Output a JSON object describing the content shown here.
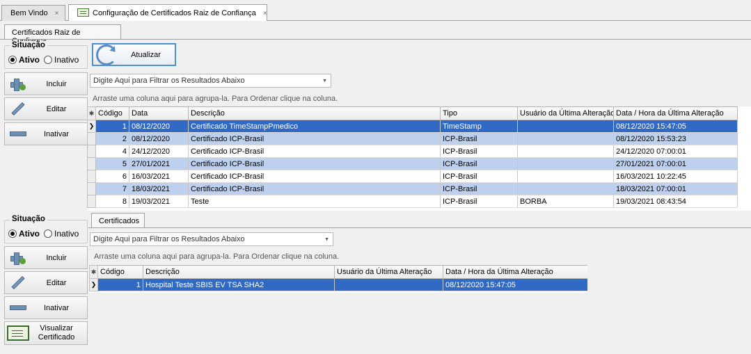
{
  "doc_tabs": [
    {
      "label": "Bem Vindo",
      "close": "×"
    },
    {
      "label": "Configuração de Certificados Raiz de Confiança",
      "close": "×"
    }
  ],
  "top": {
    "sub_tab": "Certificados Raiz de Confiança",
    "situacao": {
      "legend": "Situação",
      "ativo": "Ativo",
      "inativo": "Inativo"
    },
    "buttons": {
      "incluir": "Incluir",
      "editar": "Editar",
      "inativar": "Inativar"
    },
    "atualizar": "Atualizar",
    "filter_placeholder": "Digite Aqui para Filtrar os Resultados Abaixo",
    "group_hint": "Arraste uma coluna aqui para agrupa-la. Para Ordenar clique na coluna.",
    "columns": [
      "Código",
      "Data",
      "Descrição",
      "Tipo",
      "Usuário da Última Alteração",
      "Data / Hora da Última Alteração"
    ],
    "rows": [
      [
        "1",
        "08/12/2020",
        "Certificado TimeStampPmedico",
        "TimeStamp",
        "",
        "08/12/2020 15:47:05"
      ],
      [
        "2",
        "08/12/2020",
        "Certificado ICP-Brasil",
        "ICP-Brasil",
        "",
        "08/12/2020 15:53:23"
      ],
      [
        "4",
        "24/12/2020",
        "Certificado ICP-Brasil",
        "ICP-Brasil",
        "",
        "24/12/2020 07:00:01"
      ],
      [
        "5",
        "27/01/2021",
        "Certificado ICP-Brasil",
        "ICP-Brasil",
        "",
        "27/01/2021 07:00:01"
      ],
      [
        "6",
        "16/03/2021",
        "Certificado ICP-Brasil",
        "ICP-Brasil",
        "",
        "16/03/2021 10:22:45"
      ],
      [
        "7",
        "18/03/2021",
        "Certificado ICP-Brasil",
        "ICP-Brasil",
        "",
        "18/03/2021 07:00:01"
      ],
      [
        "8",
        "19/03/2021",
        "Teste",
        "ICP-Brasil",
        "BORBA",
        "19/03/2021 08:43:54"
      ]
    ]
  },
  "bottom": {
    "sub_tab": "Certificados",
    "situacao": {
      "legend": "Situação",
      "ativo": "Ativo",
      "inativo": "Inativo"
    },
    "buttons": {
      "incluir": "Incluir",
      "editar": "Editar",
      "inativar": "Inativar",
      "visualizar_1": "Visualizar",
      "visualizar_2": "Certificado"
    },
    "filter_placeholder": "Digite Aqui para Filtrar os Resultados Abaixo",
    "group_hint": "Arraste uma coluna aqui para agrupa-la. Para Ordenar clique na coluna.",
    "columns": [
      "Código",
      "Descrição",
      "Usuário da Última Alteração",
      "Data / Hora da Última Alteração"
    ],
    "rows": [
      [
        "1",
        "Hospital Teste SBIS EV TSA SHA2",
        "",
        "08/12/2020 15:47:05"
      ]
    ]
  },
  "colors": {
    "selected_row": "#316ac5",
    "alt_row": "#bdd1ee",
    "accent_border": "#4a8fd1"
  }
}
